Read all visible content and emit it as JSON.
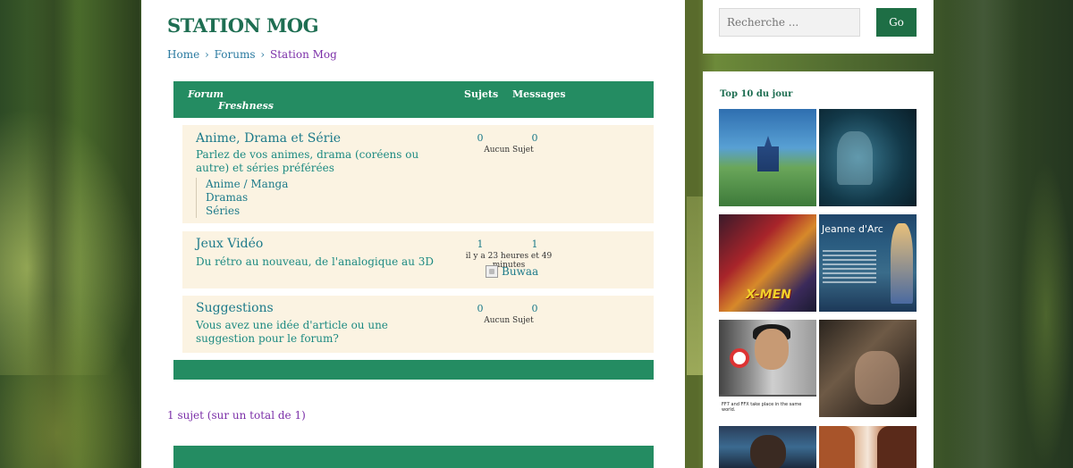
{
  "site": {
    "title": "STATION MOG"
  },
  "breadcrumb": {
    "home": "Home",
    "separator": "›",
    "forums": "Forums",
    "current": "Station Mog"
  },
  "forum_table": {
    "headers": {
      "forum": "Forum",
      "freshness": "Freshness",
      "topics": "Sujets",
      "posts": "Messages"
    },
    "rows": [
      {
        "title": "Anime, Drama et Série",
        "description": "Parlez de vos animes, drama (coréens ou autre) et séries préférées",
        "topics": "0",
        "posts": "0",
        "freshness": "Aucun Sujet",
        "subforums": [
          "Anime / Manga",
          "Dramas",
          "Séries"
        ]
      },
      {
        "title": "Jeux Vidéo",
        "description": "Du rétro au nouveau, de l'analogique au 3D",
        "topics": "1",
        "posts": "1",
        "freshness": "il y a 23 heures et 49 minutes",
        "author": "Buwaa"
      },
      {
        "title": "Suggestions",
        "description": "Vous avez une idée d'article ou une suggestion pour le forum?",
        "topics": "0",
        "posts": "0",
        "freshness": "Aucun Sujet"
      }
    ]
  },
  "pagination": {
    "text": "1 sujet (sur un total de 1)"
  },
  "search": {
    "placeholder": "Recherche ...",
    "button": "Go"
  },
  "top10": {
    "title": "Top 10 du jour",
    "thumb_texts": {
      "t3_logo": "X-MEN",
      "t4_heading": "Jeanne d'Arc",
      "t5_caption": "FF7 and FFX take place in the same world."
    }
  },
  "colors": {
    "header_green": "#248c62",
    "title_green": "#1e6e52",
    "row_bg": "#fbf3e2",
    "link_blue": "#2a7aa0",
    "visited_purple": "#7b2fa8"
  }
}
